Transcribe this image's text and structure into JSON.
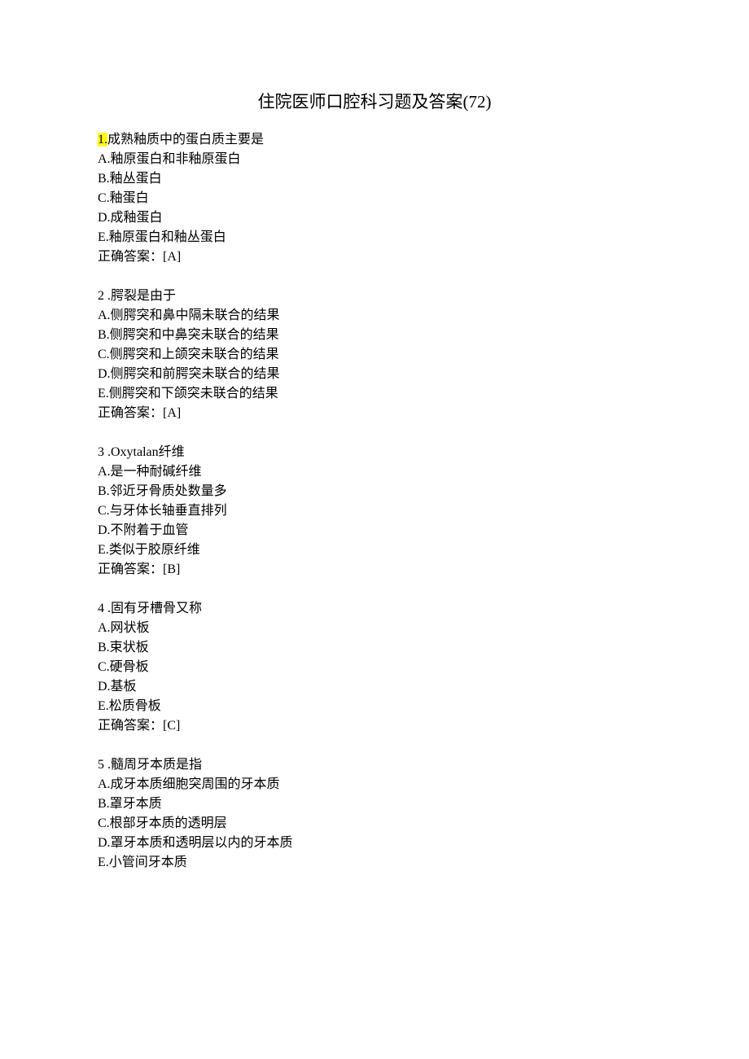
{
  "title": "住院医师口腔科习题及答案(72)",
  "questions": [
    {
      "num_prefix": "1.",
      "num_highlight": true,
      "stem": "成熟釉质中的蛋白质主要是",
      "options": [
        "A.釉原蛋白和非釉原蛋白",
        "B.釉丛蛋白",
        "C.釉蛋白",
        "D.成釉蛋白",
        "E.釉原蛋白和釉丛蛋白"
      ],
      "answer": "正确答案：[A]"
    },
    {
      "num_prefix": "2 .",
      "num_highlight": false,
      "stem": "腭裂是由于",
      "options": [
        "A.侧腭突和鼻中隔未联合的结果",
        "B.侧腭突和中鼻突未联合的结果",
        "C.侧腭突和上颌突未联合的结果",
        "D.侧腭突和前腭突未联合的结果",
        "E.侧腭突和下颌突未联合的结果"
      ],
      "answer": "正确答案：[A]"
    },
    {
      "num_prefix": "3 .",
      "num_highlight": false,
      "stem": "Oxytalan纤维",
      "options": [
        "A.是一种耐碱纤维",
        "B.邻近牙骨质处数量多",
        "C.与牙体长轴垂直排列",
        "D.不附着于血管",
        "E.类似于胶原纤维"
      ],
      "answer": "正确答案：[B]"
    },
    {
      "num_prefix": "4 .",
      "num_highlight": false,
      "stem": "固有牙槽骨又称",
      "options": [
        "A.网状板",
        "B.束状板",
        "C.硬骨板",
        "D.基板",
        "E.松质骨板"
      ],
      "answer": "正确答案：[C]"
    },
    {
      "num_prefix": "5 .",
      "num_highlight": false,
      "stem": "髓周牙本质是指",
      "options": [
        "A.成牙本质细胞突周围的牙本质",
        "B.罩牙本质",
        "C.根部牙本质的透明层",
        "D.罩牙本质和透明层以内的牙本质",
        "E.小管间牙本质"
      ],
      "answer": ""
    }
  ]
}
